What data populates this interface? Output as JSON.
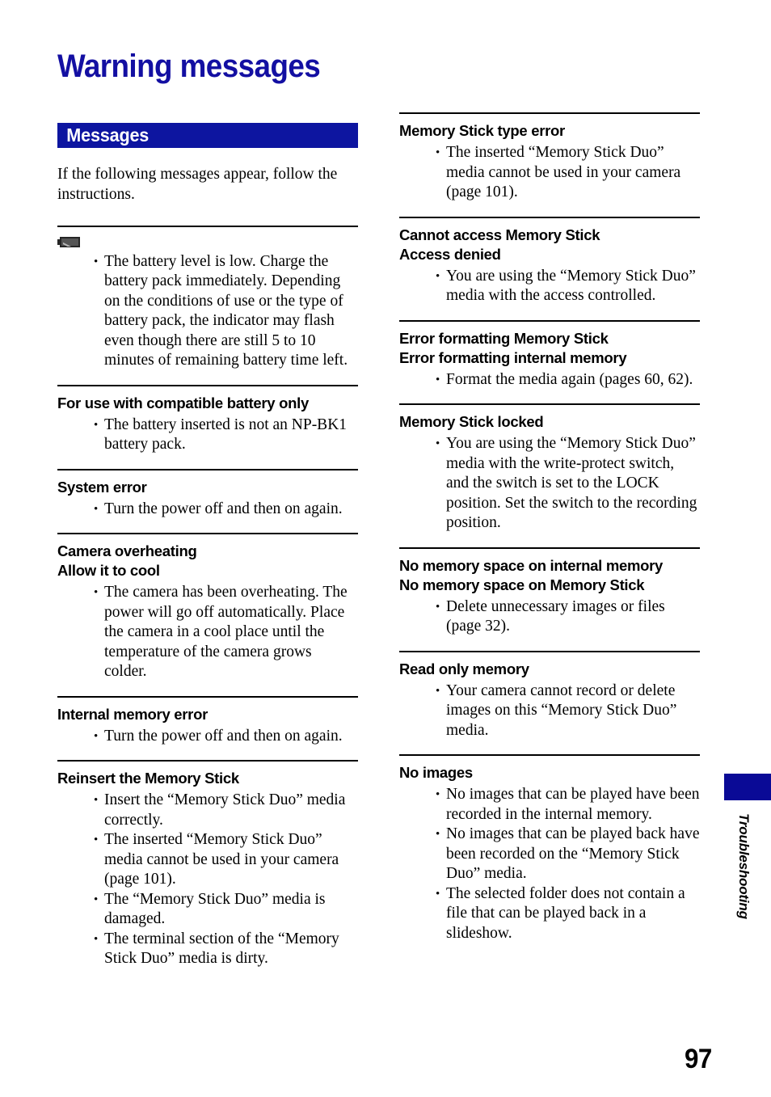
{
  "page": {
    "title": "Warning messages",
    "page_number": "97",
    "title_color": "#130fa2",
    "accent_color": "#0d15a0"
  },
  "side_tab": {
    "label": "Troubleshooting",
    "swatch_color": "#0a0a96"
  },
  "left_column": {
    "section_bar_label": "Messages",
    "intro": "If the following messages appear, follow the instructions.",
    "entries": [
      {
        "icon": "battery-low-icon",
        "heading_lines": [],
        "bullets": [
          "The battery level is low. Charge the battery pack immediately. Depending on the conditions of use or the type of battery pack, the indicator may flash even though there are still 5 to 10 minutes of remaining battery time left."
        ]
      },
      {
        "heading_lines": [
          "For use with compatible battery only"
        ],
        "bullets": [
          "The battery inserted is not an NP-BK1 battery pack."
        ]
      },
      {
        "heading_lines": [
          "System error"
        ],
        "bullets": [
          "Turn the power off and then on again."
        ]
      },
      {
        "heading_lines": [
          "Camera overheating",
          "Allow it to cool"
        ],
        "bullets": [
          "The camera has been overheating. The power will go off automatically. Place the camera in a cool place until the temperature of the camera grows colder."
        ]
      },
      {
        "heading_lines": [
          "Internal memory error"
        ],
        "bullets": [
          "Turn the power off and then on again."
        ]
      },
      {
        "heading_lines": [
          "Reinsert the Memory Stick"
        ],
        "bullets": [
          "Insert the “Memory Stick Duo” media correctly.",
          "The inserted “Memory Stick Duo” media cannot be used in your camera (page 101).",
          "The “Memory Stick Duo” media is damaged.",
          "The terminal section of the “Memory Stick Duo” media is dirty."
        ]
      }
    ]
  },
  "right_column": {
    "entries": [
      {
        "heading_lines": [
          "Memory Stick type error"
        ],
        "bullets": [
          "The inserted “Memory Stick Duo” media cannot be used in your camera (page 101)."
        ]
      },
      {
        "heading_lines": [
          "Cannot access Memory Stick",
          "Access denied"
        ],
        "bullets": [
          "You are using the “Memory Stick Duo” media with the access controlled."
        ]
      },
      {
        "heading_lines": [
          "Error formatting Memory Stick",
          "Error formatting internal memory"
        ],
        "bullets": [
          "Format the media again (pages 60, 62)."
        ]
      },
      {
        "heading_lines": [
          "Memory Stick locked"
        ],
        "bullets": [
          "You are using the “Memory Stick Duo” media with the write-protect switch, and the switch is set to the LOCK position. Set the switch to the recording position."
        ]
      },
      {
        "heading_lines": [
          "No memory space on internal memory",
          "No memory space on Memory Stick"
        ],
        "bullets": [
          "Delete unnecessary images or files (page 32)."
        ]
      },
      {
        "heading_lines": [
          "Read only memory"
        ],
        "bullets": [
          "Your camera cannot record or delete images on this “Memory Stick Duo” media."
        ]
      },
      {
        "heading_lines": [
          "No images"
        ],
        "bullets": [
          "No images that can be played have been recorded in the internal memory.",
          "No images that can be played back have been recorded on the “Memory Stick Duo” media.",
          "The selected folder does not contain a file that can be played back in a slideshow."
        ]
      }
    ]
  }
}
